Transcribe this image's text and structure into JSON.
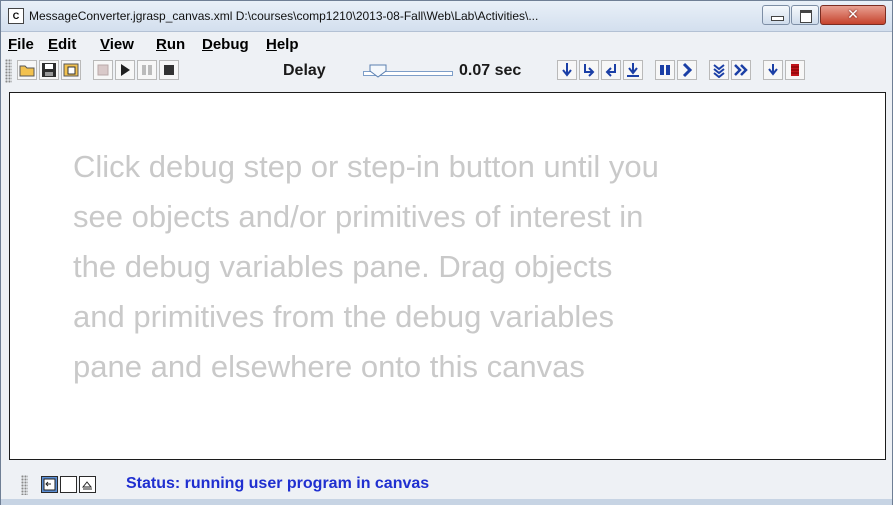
{
  "window": {
    "title": "MessageConverter.jgrasp_canvas.xml  D:\\courses\\comp1210\\2013-08-Fall\\Web\\Lab\\Activities\\...",
    "app_icon_text": "C"
  },
  "menu": {
    "items": [
      "File",
      "Edit",
      "View",
      "Run",
      "Debug",
      "Help"
    ]
  },
  "toolbar": {
    "delay_label": "Delay",
    "delay_value": "0.07 sec",
    "delay_fraction": 0.08,
    "icons": [
      "open-folder-icon",
      "save-icon",
      "open-browser-icon",
      "run-gear-icon",
      "play-icon",
      "pause-icon",
      "stop-icon",
      "step-over-icon",
      "step-in-icon",
      "step-out-icon",
      "step-in-down-icon",
      "pause-all-icon",
      "resume-icon",
      "fast-step-icon",
      "auto-step-icon",
      "step-down-icon",
      "halt-icon"
    ]
  },
  "canvas": {
    "hint_lines": [
      "Click debug step or step-in button until you",
      "see objects and/or primitives of interest in",
      "the debug variables pane. Drag objects",
      "and primitives from the debug variables",
      "pane and elsewhere onto this canvas"
    ]
  },
  "status": {
    "text": "Status: running user program in canvas"
  },
  "colors": {
    "status_text": "#1f2fd0",
    "hint_text": "#c9c9c9",
    "close_button": "#c6432d"
  }
}
